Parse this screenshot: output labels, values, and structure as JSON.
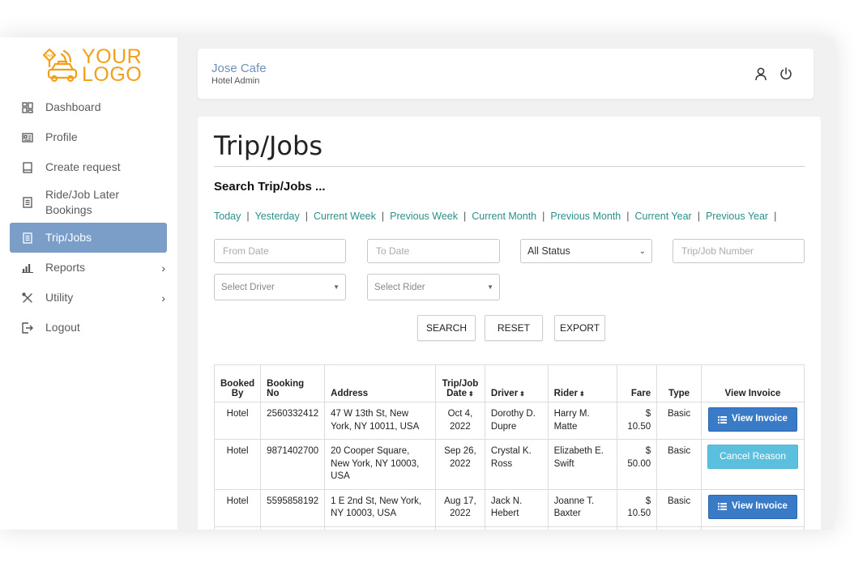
{
  "logo": {
    "line1": "YOUR",
    "line2": "LOGO",
    "badge": "TAXI",
    "color": "#f2a019"
  },
  "sidebar": {
    "items": [
      {
        "label": "Dashboard",
        "icon": "dashboard-icon"
      },
      {
        "label": "Profile",
        "icon": "profile-card-icon"
      },
      {
        "label": "Create request",
        "icon": "book-icon"
      },
      {
        "label": "Ride/Job Later Bookings",
        "icon": "document-icon"
      },
      {
        "label": "Trip/Jobs",
        "icon": "document-icon",
        "active": true
      },
      {
        "label": "Reports",
        "icon": "bar-chart-icon",
        "chevron": "›"
      },
      {
        "label": "Utility",
        "icon": "tools-icon",
        "chevron": "›"
      },
      {
        "label": "Logout",
        "icon": "logout-icon"
      }
    ],
    "active_color": "#7b9ec8"
  },
  "header": {
    "name": "Jose Cafe",
    "role": "Hotel Admin"
  },
  "page": {
    "title": "Trip/Jobs",
    "search_heading": "Search Trip/Jobs ...",
    "quick_links": [
      "Today",
      "Yesterday",
      "Current Week",
      "Previous Week",
      "Current Month",
      "Previous Month",
      "Current Year",
      "Previous Year"
    ],
    "link_separator": "|"
  },
  "filters": {
    "from_date_placeholder": "From Date",
    "to_date_placeholder": "To Date",
    "status_selected": "All Status",
    "trip_number_placeholder": "Trip/Job Number",
    "driver_placeholder": "Select Driver",
    "rider_placeholder": "Select Rider"
  },
  "buttons": {
    "search": "SEARCH",
    "reset": "RESET",
    "export": "EXPORT"
  },
  "table": {
    "headers": {
      "booked_by": "Booked By",
      "booking_no": "Booking No",
      "address": "Address",
      "date": "Trip/Job Date",
      "driver": "Driver",
      "rider": "Rider",
      "fare": "Fare",
      "type": "Type",
      "invoice": "View Invoice"
    },
    "sort_glyph": "⬍",
    "rows": [
      {
        "booked_by": "Hotel",
        "booking_no": "2560332412",
        "address": "47 W 13th St, New York, NY 10011, USA",
        "date": "Oct 4, 2022",
        "driver": "Dorothy D. Dupre",
        "rider": "Harry M. Matte",
        "fare": "$ 10.50",
        "type": "Basic",
        "action": "View Invoice",
        "action_kind": "invoice"
      },
      {
        "booked_by": "Hotel",
        "booking_no": "9871402700",
        "address": "20 Cooper Square, New York, NY 10003, USA",
        "date": "Sep 26, 2022",
        "driver": "Crystal K. Ross",
        "rider": "Elizabeth E. Swift",
        "fare": "$ 50.00",
        "type": "Basic",
        "action": "Cancel Reason",
        "action_kind": "cancel"
      },
      {
        "booked_by": "Hotel",
        "booking_no": "5595858192",
        "address": "1 E 2nd St, New York, NY 10003, USA",
        "date": "Aug 17, 2022",
        "driver": "Jack N. Hebert",
        "rider": "Joanne T. Baxter",
        "fare": "$ 10.50",
        "type": "Basic",
        "action": "View Invoice",
        "action_kind": "invoice"
      }
    ]
  },
  "colors": {
    "link": "#2b8f8a",
    "invoice_button": "#3a7bc8",
    "cancel_button": "#5bc0de",
    "header_name": "#6f8fb6"
  }
}
